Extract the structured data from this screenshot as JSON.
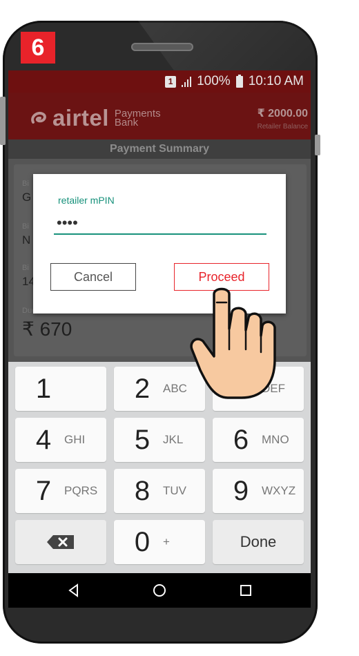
{
  "step_badge": "6",
  "status_bar": {
    "sim": "1",
    "battery_pct": "100%",
    "time": "10:10 AM"
  },
  "app_bar": {
    "brand": "airtel",
    "brand_sub_line1": "Payments",
    "brand_sub_line2": "Bank",
    "balance_amount": "₹ 2000.00",
    "balance_label": "Retailer Balance"
  },
  "page_title": "Payment Summary",
  "summary": {
    "rows": [
      {
        "label": "Bi",
        "value": "G"
      },
      {
        "label": "Bi",
        "value": "N"
      },
      {
        "label": "Bi",
        "value": "14"
      }
    ],
    "amount_label": "Due Amount",
    "amount_value": "₹ 670"
  },
  "dialog": {
    "field_label": "retailer mPIN",
    "field_value": "••••",
    "cancel_label": "Cancel",
    "proceed_label": "Proceed"
  },
  "keypad": {
    "keys": [
      {
        "digit": "1",
        "letters": ""
      },
      {
        "digit": "2",
        "letters": "ABC"
      },
      {
        "digit": "3",
        "letters": "DEF"
      },
      {
        "digit": "4",
        "letters": "GHI"
      },
      {
        "digit": "5",
        "letters": "JKL"
      },
      {
        "digit": "6",
        "letters": "MNO"
      },
      {
        "digit": "7",
        "letters": "PQRS"
      },
      {
        "digit": "8",
        "letters": "TUV"
      },
      {
        "digit": "9",
        "letters": "WXYZ"
      },
      {
        "digit": "0",
        "letters": "+"
      }
    ],
    "done_label": "Done"
  },
  "colors": {
    "brand_red": "#e8232a",
    "accent_teal": "#17917b",
    "appbar_dim": "#6b1313"
  }
}
